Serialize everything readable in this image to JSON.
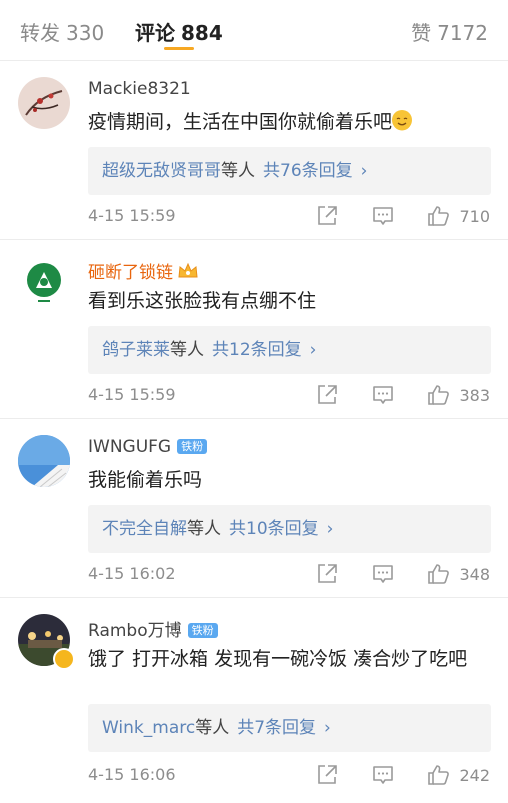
{
  "tabs": {
    "repost": {
      "label": "转发",
      "count": "330"
    },
    "comment": {
      "label": "评论",
      "count": "884"
    },
    "like": {
      "label": "赞",
      "count": "7172"
    }
  },
  "comments": [
    {
      "user": "Mackie8321",
      "text": "疫情期间，生活在中国你就偷着乐吧",
      "reply_user": "超级无敌贤哥哥",
      "reply_suffix": "等人",
      "reply_total": "共76条回复",
      "time": "4-15 15:59",
      "likes": "710"
    },
    {
      "user": "砸断了锁链",
      "text": "看到乐这张脸我有点绷不住",
      "reply_user": "鸽子莱莱",
      "reply_suffix": "等人",
      "reply_total": "共12条回复",
      "time": "4-15 15:59",
      "likes": "383"
    },
    {
      "user": "IWNGUFG",
      "badge": "铁粉",
      "text": "我能偷着乐吗",
      "reply_user": "不完全自解",
      "reply_suffix": "等人",
      "reply_total": "共10条回复",
      "time": "4-15 16:02",
      "likes": "348"
    },
    {
      "user": "Rambo万博",
      "badge": "铁粉",
      "text": "饿了 打开冰箱 发现有一碗冷饭 凑合炒了吃吧",
      "reply_user": "Wink_marc",
      "reply_suffix": "等人",
      "reply_total": "共7条回复",
      "time": "4-15 16:06",
      "likes": "242"
    }
  ],
  "icons": {
    "share": "share-icon",
    "comment": "comment-icon",
    "like": "thumbs-up-icon",
    "arrow": "chevron-right-icon",
    "arrow_glyph": "›"
  },
  "colors": {
    "accent": "#f7a823",
    "link": "#5d84b8",
    "username_orange": "#e8650e",
    "badge_blue": "#5aa8f0"
  }
}
